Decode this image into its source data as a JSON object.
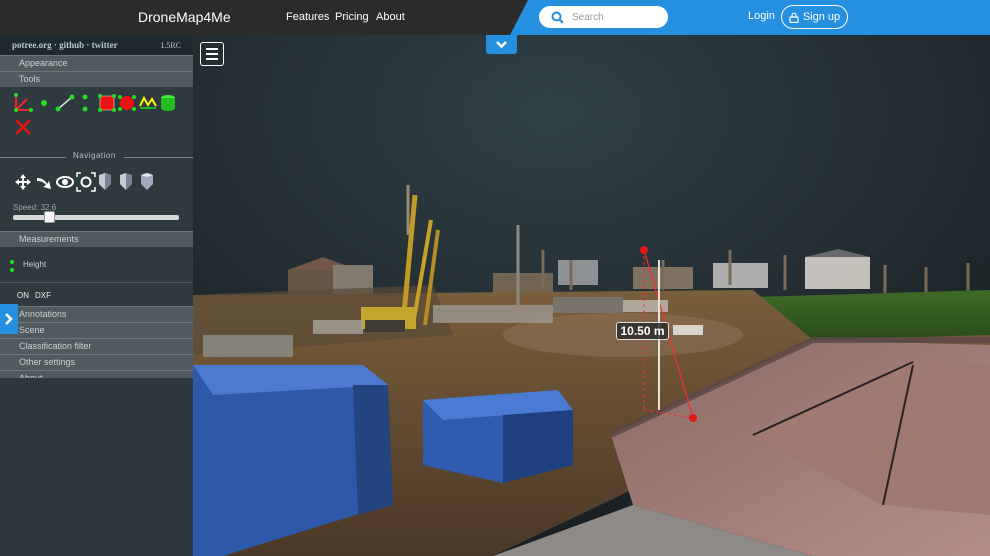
{
  "header": {
    "brand": "DroneMap4Me",
    "nav": [
      "Features",
      "Pricing",
      "About"
    ],
    "search_placeholder": "Search",
    "login_label": "Login",
    "signup_label": "Sign up"
  },
  "sidebar": {
    "top_links": "potree.org · github · twitter",
    "version": "1.5RC",
    "sections_top": [
      "Appearance",
      "Tools"
    ],
    "navigation_label": "Navigation",
    "speed_label": "Speed: 32.6",
    "speed_value": 0.2,
    "measurements_label": "Measurements",
    "measurement_items": [
      "Height"
    ],
    "export_buttons": [
      "ON",
      "DXF"
    ],
    "sections_bottom": [
      "Annotations",
      "Scene",
      "Classification filter",
      "Other settings",
      "About"
    ]
  },
  "viewer": {
    "measurement_label": "10.50 m"
  },
  "colors": {
    "accent": "#2590e0",
    "topbar": "#2b2b2b",
    "sidebar": "#2e3a3e"
  }
}
